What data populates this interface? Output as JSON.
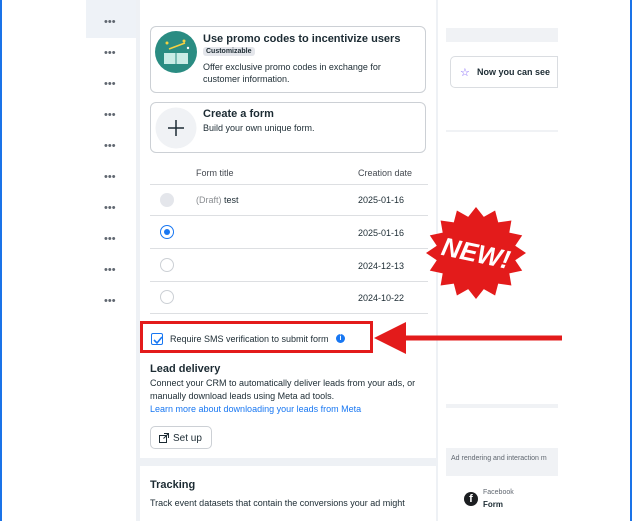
{
  "row_menu_glyph": "•••",
  "row_menus": [
    1,
    2,
    3,
    4,
    5,
    6,
    7,
    8,
    9,
    10
  ],
  "promo_option": {
    "title": "Use promo codes to incentivize users",
    "badge": "Customizable",
    "description_line1": "Offer exclusive promo codes in exchange for",
    "description_line2": "customer information."
  },
  "create_option": {
    "title": "Create a form",
    "description": "Build your own unique form."
  },
  "forms_table": {
    "columns": [
      "Form title",
      "Creation date"
    ],
    "rows": [
      {
        "status": "(Draft)",
        "title": "test",
        "date": "2025-01-16",
        "radio": "disabled"
      },
      {
        "status": "",
        "title": "",
        "date": "2025-01-16",
        "radio": "selected"
      },
      {
        "status": "",
        "title": "",
        "date": "2024-12-13",
        "radio": "empty"
      },
      {
        "status": "",
        "title": "",
        "date": "2024-10-22",
        "radio": "empty"
      }
    ]
  },
  "sms_verification": {
    "label": "Require SMS verification to submit form",
    "checked": true,
    "info_glyph": "i"
  },
  "lead_delivery": {
    "title": "Lead delivery",
    "line1": "Connect your CRM to automatically deliver leads from your ads, or",
    "line2": "manually download leads using Meta ad tools.",
    "link": "Learn more about downloading your leads from Meta",
    "button": "Set up"
  },
  "tracking": {
    "title": "Tracking",
    "text": "Track event datasets that contain the conversions your ad might"
  },
  "right_panel": {
    "notice": "Now you can see",
    "ad_rendering": "Ad rendering and interaction m",
    "page_name": "Facebook",
    "page_sub": "Form",
    "logo_glyph": "f"
  },
  "annotation": {
    "badge_text": "NEW!",
    "badge_color": "#e31b1b",
    "arrow_color": "#e31b1b"
  },
  "colors": {
    "accent": "#1877f2",
    "highlight": "#e31b1b"
  }
}
